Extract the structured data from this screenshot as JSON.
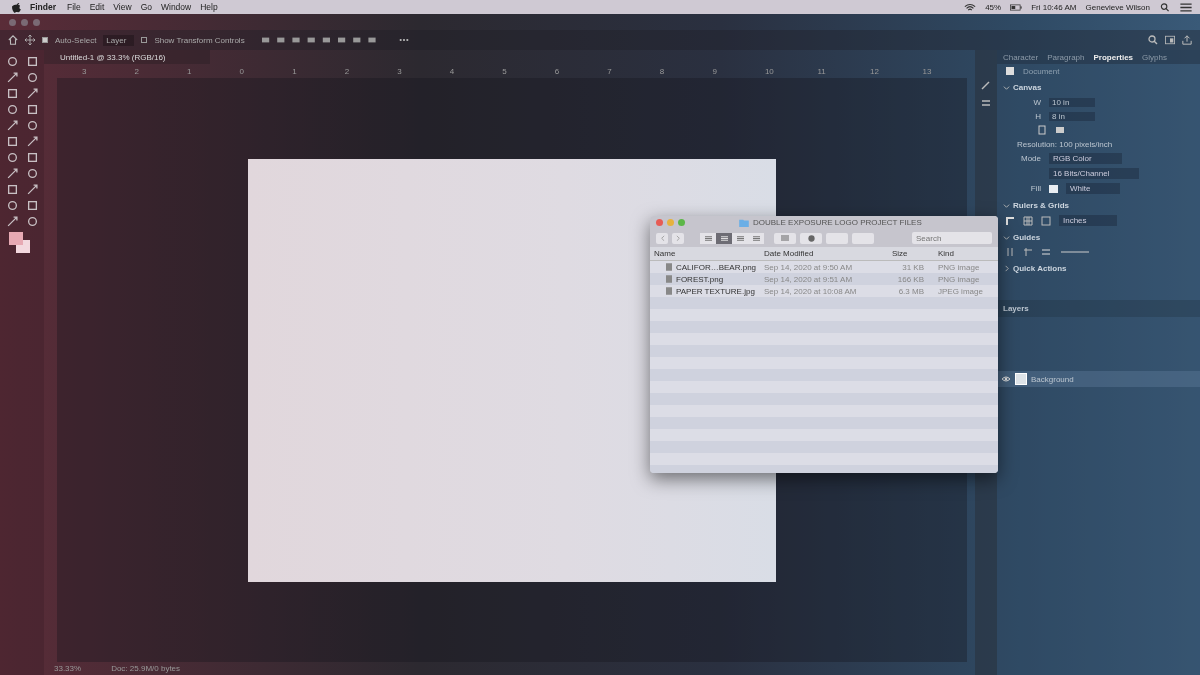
{
  "menu_bar": {
    "app": "Finder",
    "items": [
      "File",
      "Edit",
      "View",
      "Go",
      "Window",
      "Help"
    ],
    "battery": "45%",
    "clock": "Fri 10:46 AM",
    "user": "Genevieve Wilson"
  },
  "options_bar": {
    "auto_select": {
      "label": "Auto-Select",
      "checked": true
    },
    "target": "Layer",
    "transform_controls": {
      "label": "Show Transform Controls",
      "checked": false
    }
  },
  "document_tab": {
    "title": "Untitled-1 @ 33.3% (RGB/16)"
  },
  "ruler": [
    "3",
    "2",
    "1",
    "0",
    "1",
    "2",
    "3",
    "4",
    "5",
    "6",
    "7",
    "8",
    "9",
    "10",
    "11",
    "12",
    "13"
  ],
  "panel_tabs": [
    {
      "label": "Character",
      "selected": false
    },
    {
      "label": "Paragraph",
      "selected": false
    },
    {
      "label": "Properties",
      "selected": true
    },
    {
      "label": "Glyphs",
      "selected": false
    }
  ],
  "properties": {
    "header": "Document",
    "canvas": {
      "title": "Canvas",
      "expanded": true,
      "width_label": "W",
      "width": "10 in",
      "height_label": "H",
      "height": "8 in",
      "resolution": "Resolution: 100 pixels/inch",
      "mode_label": "Mode",
      "mode": "RGB Color",
      "depth": "16 Bits/Channel",
      "fill_label": "Fill",
      "fill": "White"
    },
    "rulers": {
      "title": "Rulers & Grids",
      "expanded": true,
      "units": "Inches"
    },
    "guides": {
      "title": "Guides",
      "expanded": true
    },
    "quick_actions": {
      "title": "Quick Actions",
      "expanded": false
    }
  },
  "layers": {
    "title": "Layers",
    "items": [
      {
        "name": "Background",
        "visible": true
      }
    ]
  },
  "status_bar": {
    "zoom": "33.33%",
    "doc": "Doc: 25.9M/0 bytes"
  },
  "finder": {
    "title": "DOUBLE EXPOSURE LOGO PROJECT FILES",
    "search": {
      "placeholder": "Search"
    },
    "view_modes": [
      {
        "selected": false
      },
      {
        "selected": true
      },
      {
        "selected": false
      },
      {
        "selected": false
      }
    ],
    "columns": [
      "Name",
      "Date Modified",
      "Size",
      "Kind"
    ],
    "rows": [
      {
        "name": "CALIFOR…BEAR.png",
        "date": "Sep 14, 2020 at 9:50 AM",
        "size": "31 KB",
        "kind": "PNG image"
      },
      {
        "name": "FOREST.png",
        "date": "Sep 14, 2020 at 9:51 AM",
        "size": "166 KB",
        "kind": "PNG image"
      },
      {
        "name": "PAPER TEXTURE.jpg",
        "date": "Sep 14, 2020 at 10:08 AM",
        "size": "6.3 MB",
        "kind": "JPEG image"
      }
    ]
  }
}
